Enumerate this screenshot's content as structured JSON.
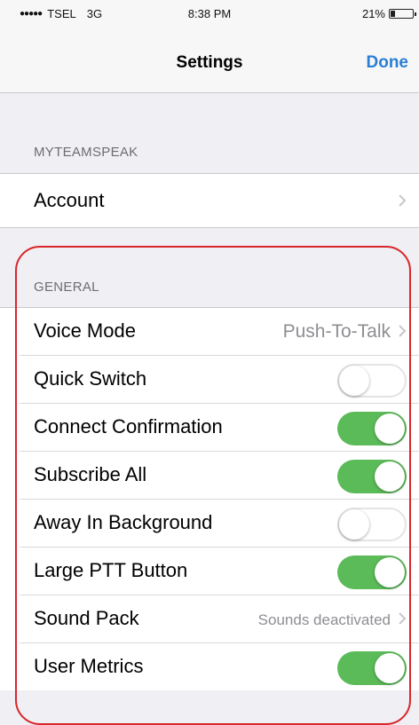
{
  "status_bar": {
    "carrier": "TSEL",
    "network": "3G",
    "time": "8:38 PM",
    "battery_percent": "21%",
    "battery_level": 0.21
  },
  "nav": {
    "title": "Settings",
    "done_label": "Done"
  },
  "sections": {
    "myteamspeak": {
      "header": "MYTEAMSPEAK",
      "account_label": "Account"
    },
    "general": {
      "header": "GENERAL",
      "voice_mode": {
        "label": "Voice Mode",
        "value": "Push-To-Talk"
      },
      "quick_switch": {
        "label": "Quick Switch",
        "on": false
      },
      "connect_confirmation": {
        "label": "Connect Confirmation",
        "on": true
      },
      "subscribe_all": {
        "label": "Subscribe All",
        "on": true
      },
      "away_in_background": {
        "label": "Away In Background",
        "on": false
      },
      "large_ptt_button": {
        "label": "Large PTT Button",
        "on": true
      },
      "sound_pack": {
        "label": "Sound Pack",
        "value": "Sounds deactivated"
      },
      "user_metrics": {
        "label": "User Metrics",
        "on": true
      }
    }
  },
  "colors": {
    "accent": "#2a7fd4",
    "toggle_on": "#5bbb58",
    "highlight": "#d8262a"
  }
}
